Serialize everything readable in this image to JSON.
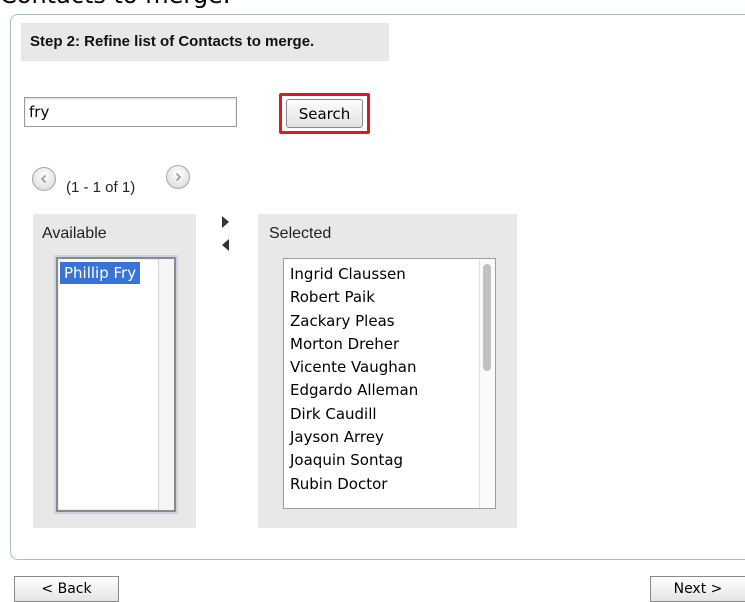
{
  "caption": "Contacts to merge.",
  "step_header": "Step 2: Refine list of Contacts to merge.",
  "search": {
    "value": "fry",
    "button_label": "Search",
    "highlight_color": "#e0191f"
  },
  "pager": {
    "text": "(1 - 1 of 1)",
    "prev_icon": "chevron-left-icon",
    "next_icon": "chevron-right-icon"
  },
  "available": {
    "label": "Available",
    "items": [
      "Phillip Fry"
    ],
    "selected_item": "Phillip Fry",
    "selection_color": "#3874d8"
  },
  "selected": {
    "label": "Selected",
    "items": [
      "Ingrid Claussen",
      "Robert Paik",
      "Zackary Pleas",
      "Morton Dreher",
      "Vicente Vaughan",
      "Edgardo Alleman",
      "Dirk Caudill",
      "Jayson Arrey",
      "Joaquin Sontag",
      "Rubin Doctor"
    ]
  },
  "transfer": {
    "move_right_icon": "triangle-right-icon",
    "move_left_icon": "triangle-left-icon"
  },
  "footer": {
    "back_label": "< Back",
    "next_label": "Next >"
  }
}
